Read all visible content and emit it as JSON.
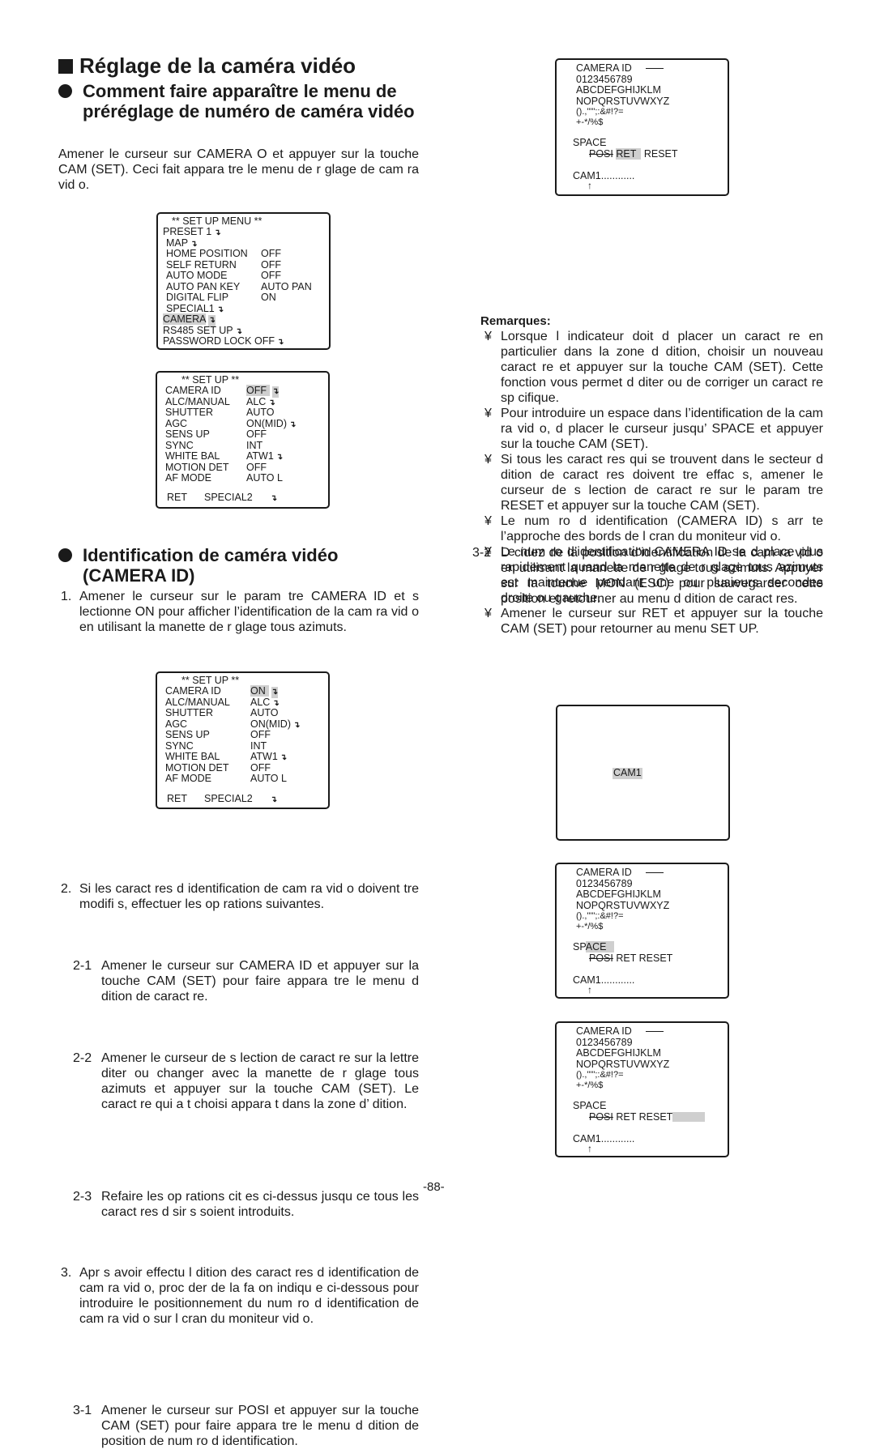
{
  "title": "Réglage de la caméra vidéo",
  "section1": {
    "heading": "Comment faire apparaître le menu de préréglage de numéro de caméra vidéo",
    "intro": "Amener le curseur sur CAMERA O  et appuyer sur la touche CAM (SET). Ceci fait appara tre le menu de r glage de cam ra vid o."
  },
  "setup_menu": {
    "title": "** SET UP MENU **",
    "items": [
      {
        "label": "PRESET 1",
        "value": "",
        "submenu": true
      },
      {
        "label": "MAP",
        "value": "",
        "submenu": true
      },
      {
        "label": "HOME POSITION",
        "value": "OFF"
      },
      {
        "label": "SELF RETURN",
        "value": "OFF"
      },
      {
        "label": "AUTO MODE",
        "value": "OFF"
      },
      {
        "label": "AUTO PAN KEY",
        "value": "AUTO PAN"
      },
      {
        "label": "DIGITAL FLIP",
        "value": "ON"
      },
      {
        "label": "SPECIAL1",
        "value": "",
        "submenu": true
      },
      {
        "label": "CAMERA",
        "value": "",
        "submenu": true,
        "selected": true
      },
      {
        "label": "RS485 SET UP",
        "value": "",
        "submenu": true
      },
      {
        "label": "PASSWORD LOCK OFF",
        "value": "",
        "submenu": true
      }
    ]
  },
  "setup_off": {
    "title": "** SET UP **",
    "items": [
      {
        "label": "CAMERA ID",
        "value": "OFF",
        "submenu": true,
        "selected": true
      },
      {
        "label": "ALC/MANUAL",
        "value": "ALC",
        "submenu": true
      },
      {
        "label": "SHUTTER",
        "value": "AUTO"
      },
      {
        "label": "AGC",
        "value": "ON(MID)",
        "submenu": true
      },
      {
        "label": "SENS UP",
        "value": "OFF"
      },
      {
        "label": "SYNC",
        "value": "INT"
      },
      {
        "label": "WHITE BAL",
        "value": "ATW1",
        "submenu": true
      },
      {
        "label": "MOTION DET",
        "value": "OFF"
      },
      {
        "label": "AF MODE",
        "value": "AUTO L"
      }
    ],
    "footer_left": "RET",
    "footer_right": "SPECIAL2"
  },
  "section2": {
    "heading_line1": "Identification de caméra vidéo",
    "heading_line2": "(CAMERA ID)",
    "step1_num": "1.",
    "step1": "Amener le curseur sur le param tre CAMERA ID et s lectionne ON pour afficher l’identification de la cam ra vid o en utilisant la manette de r glage tous azimuts."
  },
  "setup_on": {
    "title": "** SET UP **",
    "items": [
      {
        "label": "CAMERA ID",
        "value": "ON",
        "submenu": true,
        "selected": true
      },
      {
        "label": "ALC/MANUAL",
        "value": "ALC",
        "submenu": true
      },
      {
        "label": "SHUTTER",
        "value": "AUTO"
      },
      {
        "label": "AGC",
        "value": "ON(MID)",
        "submenu": true
      },
      {
        "label": "SENS UP",
        "value": "OFF"
      },
      {
        "label": "SYNC",
        "value": "INT"
      },
      {
        "label": "WHITE BAL",
        "value": "ATW1",
        "submenu": true
      },
      {
        "label": "MOTION DET",
        "value": "OFF"
      },
      {
        "label": "AF MODE",
        "value": "AUTO L"
      }
    ],
    "footer_left": "RET",
    "footer_right": "SPECIAL2"
  },
  "steps": {
    "s2_num": "2.",
    "s2": "Si les caract res d identification de cam ra vid o doivent  tre modifi s, effectuer les op rations suivantes.",
    "s2_1_num": "2-1",
    "s2_1": "Amener le curseur sur CAMERA ID et appuyer sur la touche CAM (SET) pour faire appara tre le menu d dition de caract re.",
    "s2_2_num": "2-2",
    "s2_2": "Amener le curseur de s lection de caract re sur la lettre  diter ou  changer avec la manette de r glage tous azimuts et appuyer sur la touche CAM (SET). Le caract re qui a  t  choisi appara t dans la zone d’ dition.",
    "s2_3_num": "2-3",
    "s2_3": "Refaire les op rations cit es ci-dessus jusqu ce tous les caract res d sir s soient introduits.",
    "s3_num": "3.",
    "s3": "Apr s avoir effectu  l dition des caract res d identification de cam ra vid o, proc der de la fa on indiqu e ci-dessous pour introduire le positionnement du num ro d identification de cam ra vid o sur l cran du moniteur vid o.",
    "s3_1_num": "3-1",
    "s3_1": "Amener le curseur sur POSI et appuyer sur la touche CAM (SET) pour faire appara tre le menu d dition de position de num ro d identification.",
    "s3_2_num": "3-2",
    "s3_2": "D cidez de la position d’identification de la cam ra vid o en utilisant la manette de r glage tous azimuts. Appuyer sur la touche MON (ESC) pour sauvegarder cette position et retourner au menu d dition de caract res."
  },
  "camera_id_screen": {
    "title": "CAMERA ID",
    "rows": [
      "0123456789",
      "ABCDEFGHIJKLM",
      "NOPQRSTUVWXYZ",
      "().,'\"\";:&#!?=",
      "+-*/%$"
    ],
    "space": "SPACE",
    "posi": "POSI",
    "ret": "RET",
    "reset": "RESET",
    "cam": "CAM1............",
    "cursor": "↑"
  },
  "remarks": {
    "title": "Remarques:",
    "bullet": "¥",
    "items": [
      "Lorsque l indicateur doit d placer un caract re en particulier dans la zone d dition, choisir un nouveau caract re et appuyer sur la touche CAM (SET). Cette fonction vous permet d diter ou de corriger un caract re sp cifique.",
      "Pour introduire un espace dans l’identification de la cam ra vid o, d placer le curseur jusqu’ SPACE et appuyer sur la touche CAM (SET).",
      "Si tous les caract res qui se trouvent dans le secteur d dition de caract res doivent  tre effac s, amener le curseur de s lection de caract re sur le param tre RESET et appuyer sur la touche CAM (SET).",
      "Le num ro d identification (CAMERA ID) s arr te  l’approche des bords de l cran du moniteur vid o.",
      "Le num ro d’identification CAMERA ID se d place plus rapidement quand la manette de r glage tous azimuts est maintenue pendant une ou plusieurs secondes  droite ou  gauche.",
      "Amener le curseur sur RET et appuyer sur la touche CAM (SET) pour retourner au menu SET UP."
    ]
  },
  "monitor": {
    "cam_label": "CAM1"
  },
  "page_number": "-88-"
}
